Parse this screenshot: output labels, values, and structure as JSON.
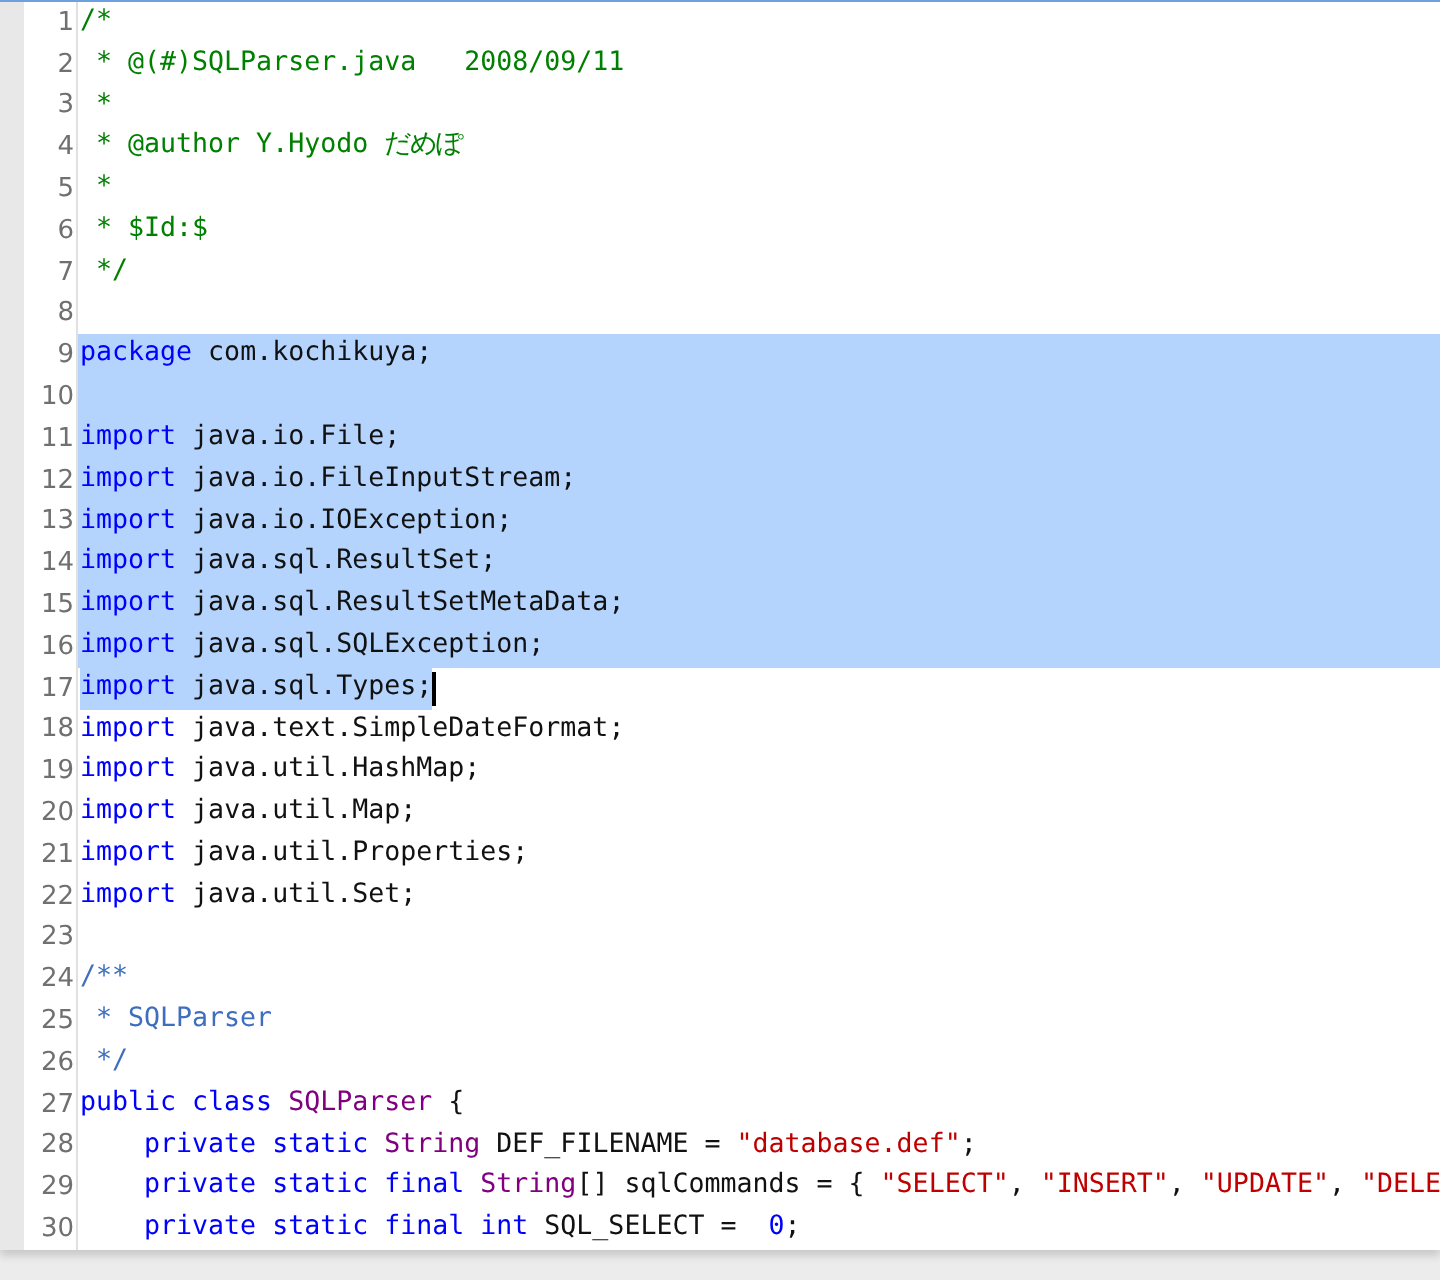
{
  "editor": {
    "lines": [
      {
        "number": "1",
        "selected": false,
        "tokens": [
          {
            "kind": "comment",
            "text": "/*"
          }
        ]
      },
      {
        "number": "2",
        "selected": false,
        "tokens": [
          {
            "kind": "comment",
            "text": " * @(#)SQLParser.java   2008/09/11"
          }
        ]
      },
      {
        "number": "3",
        "selected": false,
        "tokens": [
          {
            "kind": "comment",
            "text": " *"
          }
        ]
      },
      {
        "number": "4",
        "selected": false,
        "tokens": [
          {
            "kind": "comment",
            "text": " * @author Y.Hyodo だめぽ"
          }
        ]
      },
      {
        "number": "5",
        "selected": false,
        "tokens": [
          {
            "kind": "comment",
            "text": " *"
          }
        ]
      },
      {
        "number": "6",
        "selected": false,
        "tokens": [
          {
            "kind": "comment",
            "text": " * $Id:$"
          }
        ]
      },
      {
        "number": "7",
        "selected": false,
        "tokens": [
          {
            "kind": "comment",
            "text": " */"
          }
        ]
      },
      {
        "number": "8",
        "selected": false
      },
      {
        "number": "9",
        "selected": true,
        "tokens": [
          {
            "kind": "keyword",
            "text": "package"
          },
          {
            "kind": "plain",
            "text": " com.kochikuya;"
          }
        ]
      },
      {
        "number": "10",
        "selected": true
      },
      {
        "number": "11",
        "selected": true,
        "tokens": [
          {
            "kind": "keyword",
            "text": "import"
          },
          {
            "kind": "plain",
            "text": " java.io.File;"
          }
        ]
      },
      {
        "number": "12",
        "selected": true,
        "tokens": [
          {
            "kind": "keyword",
            "text": "import"
          },
          {
            "kind": "plain",
            "text": " java.io.FileInputStream;"
          }
        ]
      },
      {
        "number": "13",
        "selected": true,
        "tokens": [
          {
            "kind": "keyword",
            "text": "import"
          },
          {
            "kind": "plain",
            "text": " java.io.IOException;"
          }
        ]
      },
      {
        "number": "14",
        "selected": true,
        "tokens": [
          {
            "kind": "keyword",
            "text": "import"
          },
          {
            "kind": "plain",
            "text": " java.sql.ResultSet;"
          }
        ]
      },
      {
        "number": "15",
        "selected": true,
        "tokens": [
          {
            "kind": "keyword",
            "text": "import"
          },
          {
            "kind": "plain",
            "text": " java.sql.ResultSetMetaData;"
          }
        ]
      },
      {
        "number": "16",
        "selected": true,
        "tokens": [
          {
            "kind": "keyword",
            "text": "import"
          },
          {
            "kind": "plain",
            "text": " java.sql.SQLException;"
          }
        ]
      },
      {
        "number": "17",
        "selected": true,
        "cursor": true,
        "tokens": [
          {
            "kind": "keyword",
            "text": "import"
          },
          {
            "kind": "plain",
            "text": " java.sql.Types;"
          }
        ]
      },
      {
        "number": "18",
        "selected": false,
        "tokens": [
          {
            "kind": "keyword",
            "text": "import"
          },
          {
            "kind": "plain",
            "text": " java.text.SimpleDateFormat;"
          }
        ]
      },
      {
        "number": "19",
        "selected": false,
        "tokens": [
          {
            "kind": "keyword",
            "text": "import"
          },
          {
            "kind": "plain",
            "text": " java.util.HashMap;"
          }
        ]
      },
      {
        "number": "20",
        "selected": false,
        "tokens": [
          {
            "kind": "keyword",
            "text": "import"
          },
          {
            "kind": "plain",
            "text": " java.util.Map;"
          }
        ]
      },
      {
        "number": "21",
        "selected": false,
        "tokens": [
          {
            "kind": "keyword",
            "text": "import"
          },
          {
            "kind": "plain",
            "text": " java.util.Properties;"
          }
        ]
      },
      {
        "number": "22",
        "selected": false,
        "tokens": [
          {
            "kind": "keyword",
            "text": "import"
          },
          {
            "kind": "plain",
            "text": " java.util.Set;"
          }
        ]
      },
      {
        "number": "23",
        "selected": false
      },
      {
        "number": "24",
        "selected": false,
        "tokens": [
          {
            "kind": "doc",
            "text": "/**"
          }
        ]
      },
      {
        "number": "25",
        "selected": false,
        "tokens": [
          {
            "kind": "doc",
            "text": " * SQLParser"
          }
        ]
      },
      {
        "number": "26",
        "selected": false,
        "tokens": [
          {
            "kind": "doc",
            "text": " */"
          }
        ]
      },
      {
        "number": "27",
        "selected": false,
        "tokens": [
          {
            "kind": "keyword",
            "text": "public class "
          },
          {
            "kind": "type",
            "text": "SQLParser"
          },
          {
            "kind": "plain",
            "text": " {"
          }
        ]
      },
      {
        "number": "28",
        "selected": false,
        "tokens": [
          {
            "kind": "keyword",
            "text": "    private static "
          },
          {
            "kind": "type",
            "text": "String"
          },
          {
            "kind": "plain",
            "text": " DEF_FILENAME = "
          },
          {
            "kind": "string",
            "text": "\"database.def\""
          },
          {
            "kind": "plain",
            "text": ";"
          }
        ]
      },
      {
        "number": "29",
        "selected": false,
        "tokens": [
          {
            "kind": "keyword",
            "text": "    private static final "
          },
          {
            "kind": "type",
            "text": "String"
          },
          {
            "kind": "plain",
            "text": "[] sqlCommands = { "
          },
          {
            "kind": "string",
            "text": "\"SELECT\""
          },
          {
            "kind": "plain",
            "text": ", "
          },
          {
            "kind": "string",
            "text": "\"INSERT\""
          },
          {
            "kind": "plain",
            "text": ", "
          },
          {
            "kind": "string",
            "text": "\"UPDATE\""
          },
          {
            "kind": "plain",
            "text": ", "
          },
          {
            "kind": "string",
            "text": "\"DELE"
          }
        ]
      },
      {
        "number": "30",
        "selected": false,
        "tokens": [
          {
            "kind": "keyword",
            "text": "    private static final int"
          },
          {
            "kind": "plain",
            "text": " SQL_SELECT =  "
          },
          {
            "kind": "number",
            "text": "0"
          },
          {
            "kind": "plain",
            "text": ";"
          }
        ]
      }
    ]
  }
}
